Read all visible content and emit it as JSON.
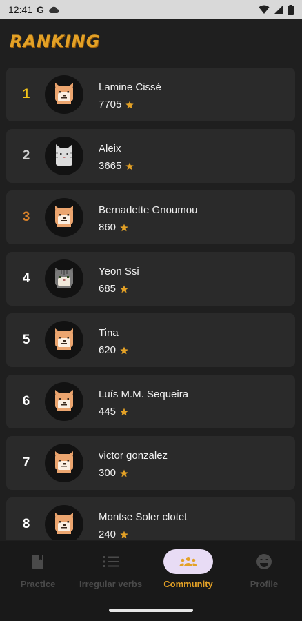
{
  "status_bar": {
    "time": "12:41",
    "g_label": "G"
  },
  "page": {
    "title": "RANKING"
  },
  "colors": {
    "accent": "#e3a126",
    "gold": "#f5c518",
    "bronze": "#d9822b",
    "star": "#e3a126"
  },
  "ranking": [
    {
      "rank": "1",
      "name": "Lamine Cissé",
      "score": "7705",
      "avatar": "shiba-icon"
    },
    {
      "rank": "2",
      "name": "Aleix",
      "score": "3665",
      "avatar": "white-cat-icon"
    },
    {
      "rank": "3",
      "name": "Bernadette Gnoumou",
      "score": "860",
      "avatar": "shiba-icon"
    },
    {
      "rank": "4",
      "name": "Yeon Ssi",
      "score": "685",
      "avatar": "tabby-cat-icon"
    },
    {
      "rank": "5",
      "name": "Tina",
      "score": "620",
      "avatar": "shiba-icon"
    },
    {
      "rank": "6",
      "name": "Luís M.M. Sequeira",
      "score": "445",
      "avatar": "shiba-icon"
    },
    {
      "rank": "7",
      "name": "victor gonzalez",
      "score": "300",
      "avatar": "shiba-icon"
    },
    {
      "rank": "8",
      "name": "Montse Soler clotet",
      "score": "240",
      "avatar": "shiba-icon"
    }
  ],
  "nav": {
    "practice": "Practice",
    "irregular_verbs": "Irregular verbs",
    "community": "Community",
    "profile": "Profile",
    "active": "community"
  }
}
